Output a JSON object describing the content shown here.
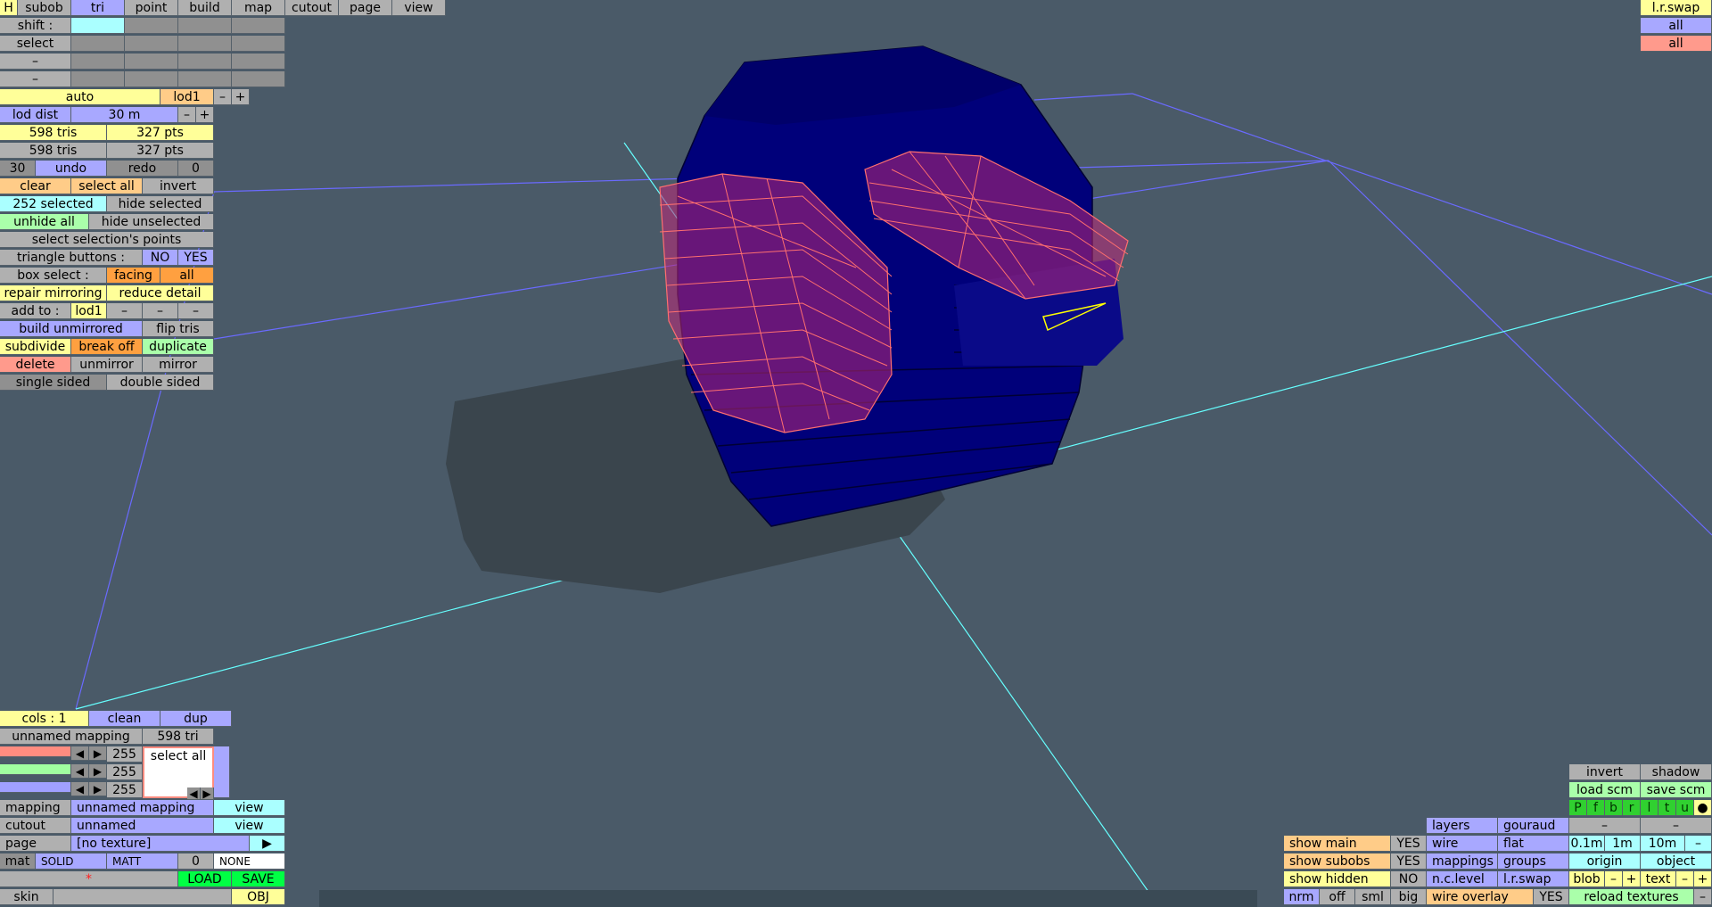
{
  "top_menu": {
    "h": "H",
    "subob": "subob",
    "tri": "tri",
    "point": "point",
    "build": "build",
    "map": "map",
    "cutout": "cutout",
    "page": "page",
    "view": "view"
  },
  "shift_label": "shift :",
  "select_label": "select",
  "dash": "–",
  "lod": {
    "auto": "auto",
    "lod1": "lod1",
    "minus": "–",
    "plus": "+",
    "dist_label": "lod dist",
    "dist_value": "30 m"
  },
  "stats": {
    "tris1": "598 tris",
    "pts1": "327 pts",
    "tris2": "598 tris",
    "pts2": "327 pts"
  },
  "undo": {
    "count": "30",
    "undo": "undo",
    "redo": "redo",
    "redo_count": "0"
  },
  "selection": {
    "clear": "clear",
    "select_all": "select all",
    "invert": "invert",
    "selected": "252 selected",
    "hide_selected": "hide selected",
    "unhide_all": "unhide all",
    "hide_unselected": "hide unselected",
    "select_points": "select selection's points"
  },
  "tri_buttons": {
    "label": "triangle buttons :",
    "no": "NO",
    "yes": "YES"
  },
  "box_select": {
    "label": "box select :",
    "facing": "facing",
    "all": "all"
  },
  "ops": {
    "repair": "repair mirroring",
    "reduce": "reduce detail",
    "add_to": "add to :",
    "add_lod": "lod1",
    "build_unmirrored": "build unmirrored",
    "flip": "flip tris",
    "subdivide": "subdivide",
    "break_off": "break off",
    "duplicate": "duplicate",
    "delete": "delete",
    "unmirror": "unmirror",
    "mirror": "mirror",
    "single": "single sided",
    "double": "double sided"
  },
  "top_right": {
    "lr_swap": "l.r.swap",
    "all1": "all",
    "all2": "all"
  },
  "cols": {
    "label": "cols : 1",
    "clean": "clean",
    "dup": "dup"
  },
  "mapping_panel": {
    "name": "unnamed mapping",
    "tris": "598 tri",
    "r": "255",
    "g": "255",
    "b": "255",
    "select_all": "select all",
    "arrow_l": "◀",
    "arrow_r": "▶"
  },
  "bottom_left": {
    "mapping_label": "mapping",
    "mapping_value": "unnamed mapping",
    "view1": "view",
    "cutout_label": "cutout",
    "cutout_value": "unnamed",
    "view2": "view",
    "page_label": "page",
    "page_value": "[no texture]",
    "page_arrow": "▶",
    "mat": "mat",
    "solid": "SOLID",
    "matt": "MATT",
    "zero": "0",
    "none": "NONE",
    "star": "*",
    "load": "LOAD",
    "save": "SAVE",
    "skin": "skin",
    "obj": "OBJ"
  },
  "bottom_right": {
    "invert": "invert",
    "shadow": "shadow",
    "load_scm": "load scm",
    "save_scm": "save scm",
    "pfbrltu": [
      "P",
      "f",
      "b",
      "r",
      "l",
      "t",
      "u"
    ],
    "dot": "●",
    "dash": "–",
    "layers": "layers",
    "gouraud": "gouraud",
    "show_main": "show main",
    "yes1": "YES",
    "wire": "wire",
    "flat": "flat",
    "m01": "0.1m",
    "m1": "1m",
    "m10": "10m",
    "show_subobs": "show subobs",
    "yes2": "YES",
    "mappings": "mappings",
    "groups": "groups",
    "origin": "origin",
    "object": "object",
    "show_hidden": "show hidden",
    "no": "NO",
    "nclevel": "n.c.level",
    "lrswap": "l.r.swap",
    "blob": "blob",
    "minus": "–",
    "plus": "+",
    "text": "text",
    "nrm": "nrm",
    "off": "off",
    "sml": "sml",
    "big": "big",
    "wire_overlay": "wire overlay",
    "yes3": "YES",
    "reload": "reload textures"
  },
  "colors": {
    "background": "#4a5a68",
    "model": "#00007a",
    "wire_selected": "#ff6f6f",
    "grid_blue": "#6a6aff",
    "grid_cyan": "#66ffff",
    "shadow": "#3a454d"
  }
}
